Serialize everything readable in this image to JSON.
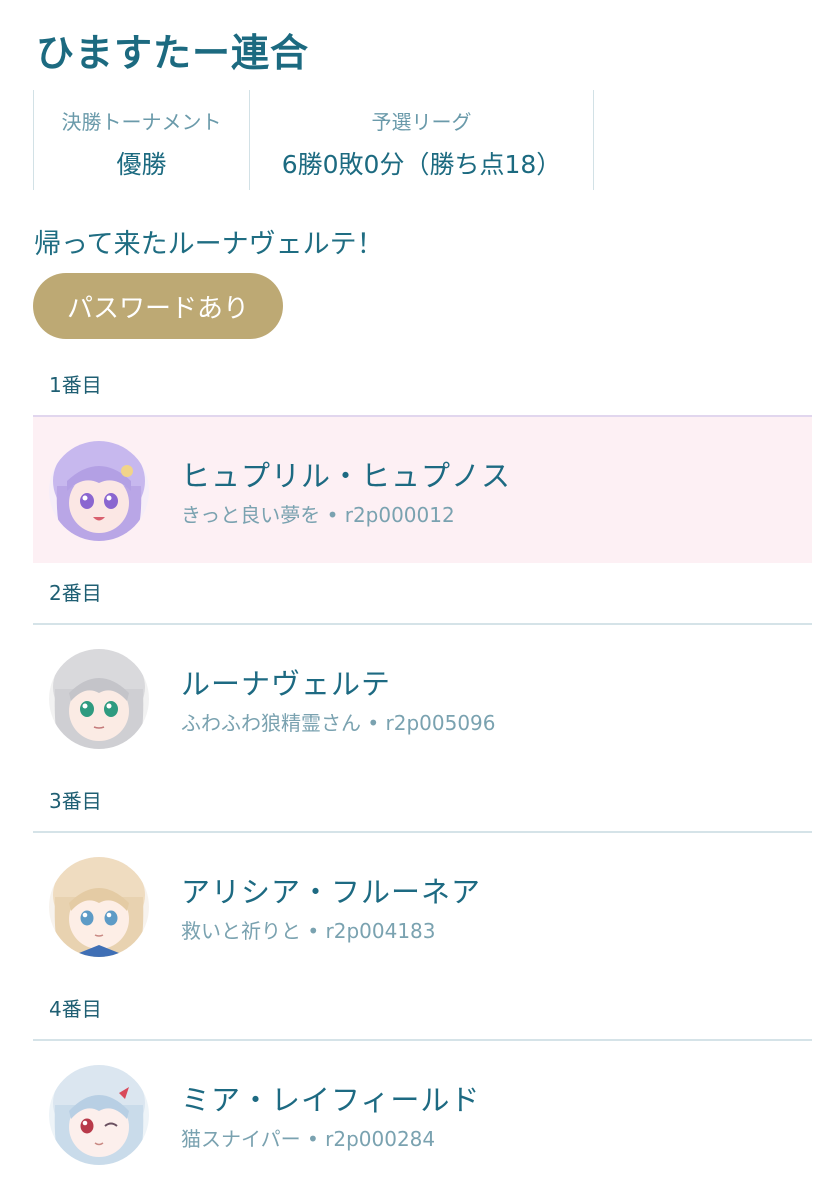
{
  "team": {
    "name": "ひますたー連合"
  },
  "results": {
    "final": {
      "label": "決勝トーナメント",
      "value": "優勝"
    },
    "league": {
      "label": "予選リーグ",
      "value": "6勝0敗0分（勝ち点18）"
    }
  },
  "comment": "帰って来たルーナヴェルテ！",
  "password_badge": "パスワードあり",
  "members": [
    {
      "order": "1番目",
      "name": "ヒュプリル・ヒュプノス",
      "subtitle": "きっと良い夢を",
      "separator": "•",
      "id": "r2p000012",
      "avatar_icon": "lavender-hair-character-avatar",
      "highlighted": true
    },
    {
      "order": "2番目",
      "name": "ルーナヴェルテ",
      "subtitle": "ふわふわ狼精霊さん",
      "separator": "•",
      "id": "r2p005096",
      "avatar_icon": "silver-hair-green-eyes-avatar",
      "highlighted": false
    },
    {
      "order": "3番目",
      "name": "アリシア・フルーネア",
      "subtitle": "救いと祈りと",
      "separator": "•",
      "id": "r2p004183",
      "avatar_icon": "blonde-hair-blue-eyes-avatar",
      "highlighted": false
    },
    {
      "order": "4番目",
      "name": "ミア・レイフィールド",
      "subtitle": "猫スナイパー",
      "separator": "•",
      "id": "r2p000284",
      "avatar_icon": "white-blue-hair-winking-avatar",
      "highlighted": false
    }
  ],
  "colors": {
    "title": "#1c6a80",
    "badge": "#bda974",
    "highlight_row": "#fdf0f4",
    "divider": "#d5e3e8"
  }
}
